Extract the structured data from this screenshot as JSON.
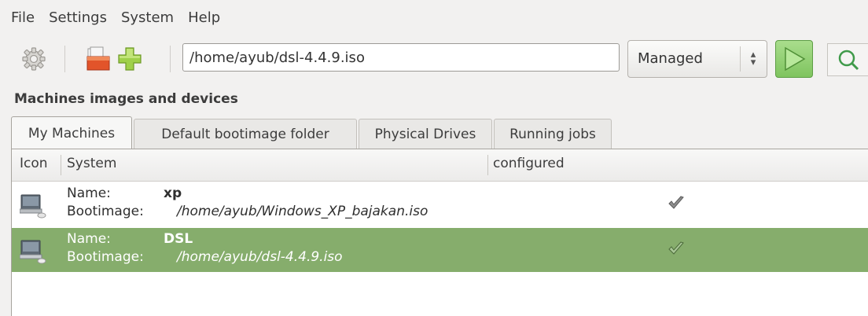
{
  "menu": [
    "File",
    "Settings",
    "System",
    "Help"
  ],
  "toolbar": {
    "path_value": "/home/ayub/dsl-4.4.9.iso",
    "mode_value": "Managed",
    "icons": [
      "gear-icon",
      "open-folder-icon",
      "add-icon",
      "run-icon",
      "search-icon"
    ],
    "run_color": "#7fc45f"
  },
  "section_title": "Machines images and devices",
  "tabs": [
    {
      "label": "My Machines",
      "active": true
    },
    {
      "label": "Default bootimage folder",
      "active": false
    },
    {
      "label": "Physical Drives",
      "active": false
    },
    {
      "label": "Running jobs",
      "active": false
    }
  ],
  "table": {
    "columns": [
      "Icon",
      "System",
      "configured"
    ],
    "rows": [
      {
        "name_label": "Name:",
        "name": "xp",
        "boot_label": "Bootimage:",
        "bootimage": "/home/ayub/Windows_XP_bajakan.iso",
        "configured": true,
        "selected": false
      },
      {
        "name_label": "Name:",
        "name": "DSL",
        "boot_label": "Bootimage:",
        "bootimage": "/home/ayub/dsl-4.4.9.iso",
        "configured": true,
        "selected": true
      }
    ]
  },
  "colors": {
    "selection": "#86ad6c",
    "background": "#f2f1f0"
  }
}
